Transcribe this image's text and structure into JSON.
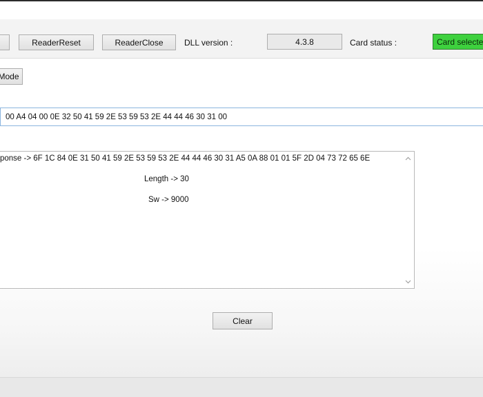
{
  "toolbar": {
    "reader_reset_label": "ReaderReset",
    "reader_close_label": "ReaderClose",
    "dll_version_label": "DLL version :",
    "dll_version_value": "4.3.8",
    "card_status_label": "Card status :",
    "card_status_value": "Card selected"
  },
  "mode_button_label": "Mode",
  "apdu": {
    "command_value": "00 A4 04 00 0E 32 50 41 59 2E 53 59 53 2E 44 44 46 30 31 00"
  },
  "output": {
    "response_line": "ponse -> 6F 1C 84 0E 31 50 41 59 2E 53 59 53 2E 44 44 46 30 31 A5 0A 88 01 01 5F 2D 04 73 72 65 6E",
    "length_line": "Length -> 30",
    "sw_line": "Sw -> 9000"
  },
  "clear_label": "Clear",
  "icons": {
    "scroll_up": "chevron-up-icon",
    "scroll_down": "chevron-down-icon"
  },
  "colors": {
    "status_green": "#3ed13e",
    "input_border": "#8ab4de"
  }
}
